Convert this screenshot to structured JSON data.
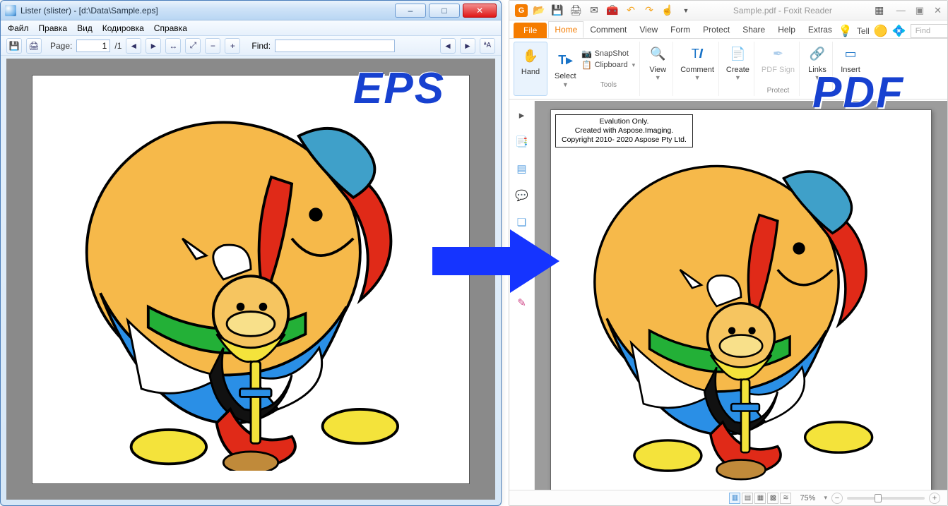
{
  "lister": {
    "title": "Lister (slister) - [d:\\Data\\Sample.eps]",
    "menus": [
      "Файл",
      "Правка",
      "Вид",
      "Кодировка",
      "Справка"
    ],
    "page_label": "Page:",
    "page_current": "1",
    "page_total": "/1",
    "find_label": "Find:",
    "find_value": ""
  },
  "foxit": {
    "title": "Sample.pdf - Foxit Reader",
    "file_tab": "File",
    "tabs": [
      "Home",
      "Comment",
      "View",
      "Form",
      "Protect",
      "Share",
      "Help",
      "Extras"
    ],
    "tell": "Tell",
    "find_placeholder": "Find",
    "ribbon": {
      "hand": "Hand",
      "select": "Select",
      "snapshot": "SnapShot",
      "clipboard": "Clipboard",
      "view": "View",
      "comment": "Comment",
      "create": "Create",
      "pdfsign": "PDF Sign",
      "links": "Links",
      "insert": "Insert",
      "tools_group": "Tools",
      "protect_group": "Protect"
    },
    "eval": {
      "l1": "Evalution Only.",
      "l2": "Created with Aspose.Imaging.",
      "l3": "Copyright 2010- 2020 Aspose Pty Ltd."
    },
    "zoom": "75%"
  },
  "overlays": {
    "eps": "EPS",
    "pdf": "PDF"
  }
}
